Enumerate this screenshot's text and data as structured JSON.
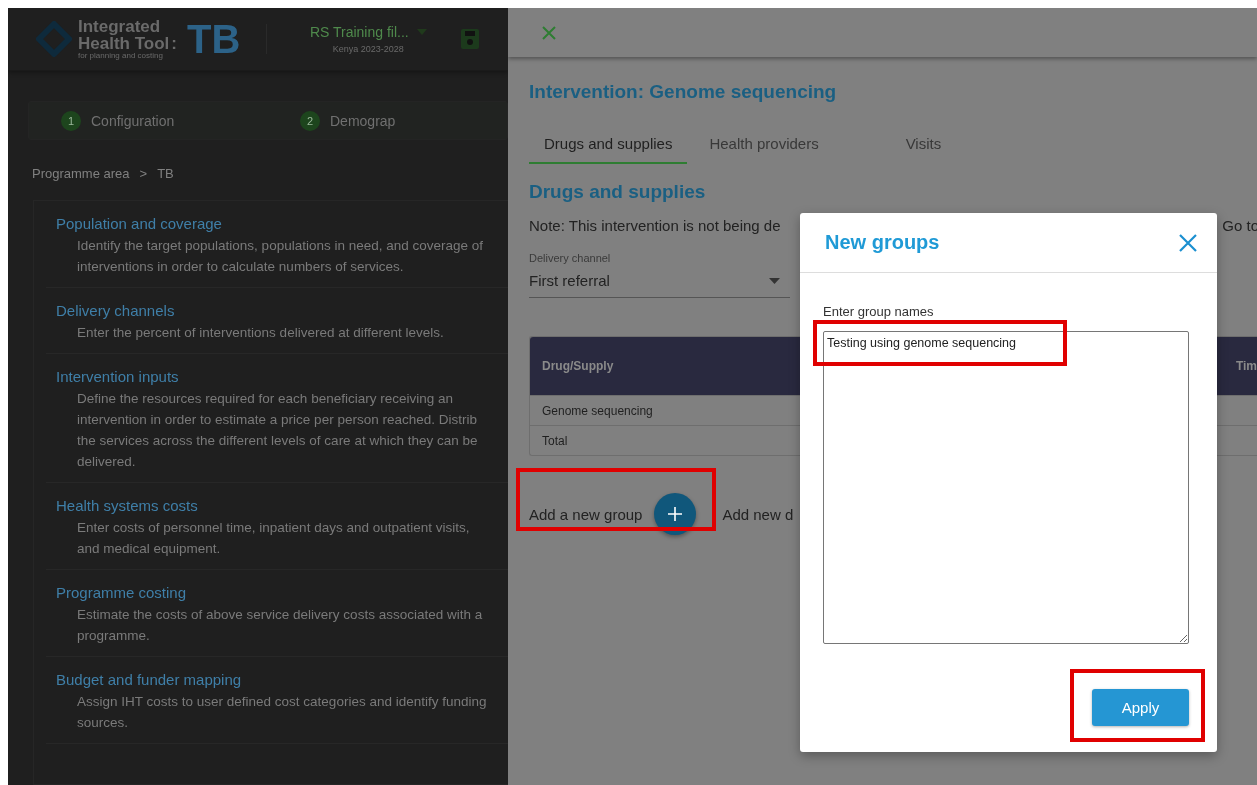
{
  "app_header": {
    "logo_line1": "Integrated",
    "logo_line2": "Health Tool",
    "logo_tagline": "for planning and costing",
    "logo_colon": ":",
    "module": "TB",
    "file_name": "RS Training fil...",
    "file_subtitle": "Kenya 2023-2028"
  },
  "stepper": [
    {
      "number": "1",
      "label": "Configuration"
    },
    {
      "number": "2",
      "label": "Demograp"
    }
  ],
  "breadcrumb": {
    "items": [
      "Programme area",
      "TB"
    ],
    "separator": ">"
  },
  "sections": [
    {
      "title": "Population and coverage",
      "description": "Identify the target populations, populations in need, and coverage of interventions in order to calculate numbers of services."
    },
    {
      "title": "Delivery channels",
      "description": "Enter the percent of interventions delivered at different levels."
    },
    {
      "title": "Intervention inputs",
      "description": "Define the resources required for each beneficiary receiving an intervention in order to estimate a price per person reached. Distrib the services across the different levels of care at which they can be delivered."
    },
    {
      "title": "Health systems costs",
      "description": "Enter costs of personnel time, inpatient days and outpatient visits, and medical equipment."
    },
    {
      "title": "Programme costing",
      "description": "Estimate the costs of above service delivery costs associated with a programme."
    },
    {
      "title": "Budget and funder mapping",
      "description": "Assign IHT costs to user defined cost categories and identify funding sources."
    }
  ],
  "drawer": {
    "title": "Intervention: Genome sequencing",
    "tabs": [
      {
        "label": "Drugs and supplies",
        "selected": true
      },
      {
        "label": "Health providers",
        "selected": false
      },
      {
        "label": "Visits",
        "selected": false
      }
    ],
    "section_title": "Drugs and supplies",
    "note": "Note: This intervention is not being de",
    "note_link": "Go to",
    "delivery_channel": {
      "label": "Delivery channel",
      "value": "First referral"
    },
    "table": {
      "columns": [
        "Drug/Supply",
        "Tim"
      ],
      "rows": [
        [
          "Genome sequencing"
        ],
        [
          "Total"
        ]
      ]
    },
    "add_group": {
      "label": "Add a new group",
      "highlighted": true
    },
    "add_drug_label": "Add new d"
  },
  "modal": {
    "title": "New groups",
    "field_label": "Enter group names",
    "field": {
      "value": "Testing using genome sequencing",
      "highlighted": true
    },
    "apply_button": {
      "label": "Apply",
      "highlighted": true
    }
  }
}
